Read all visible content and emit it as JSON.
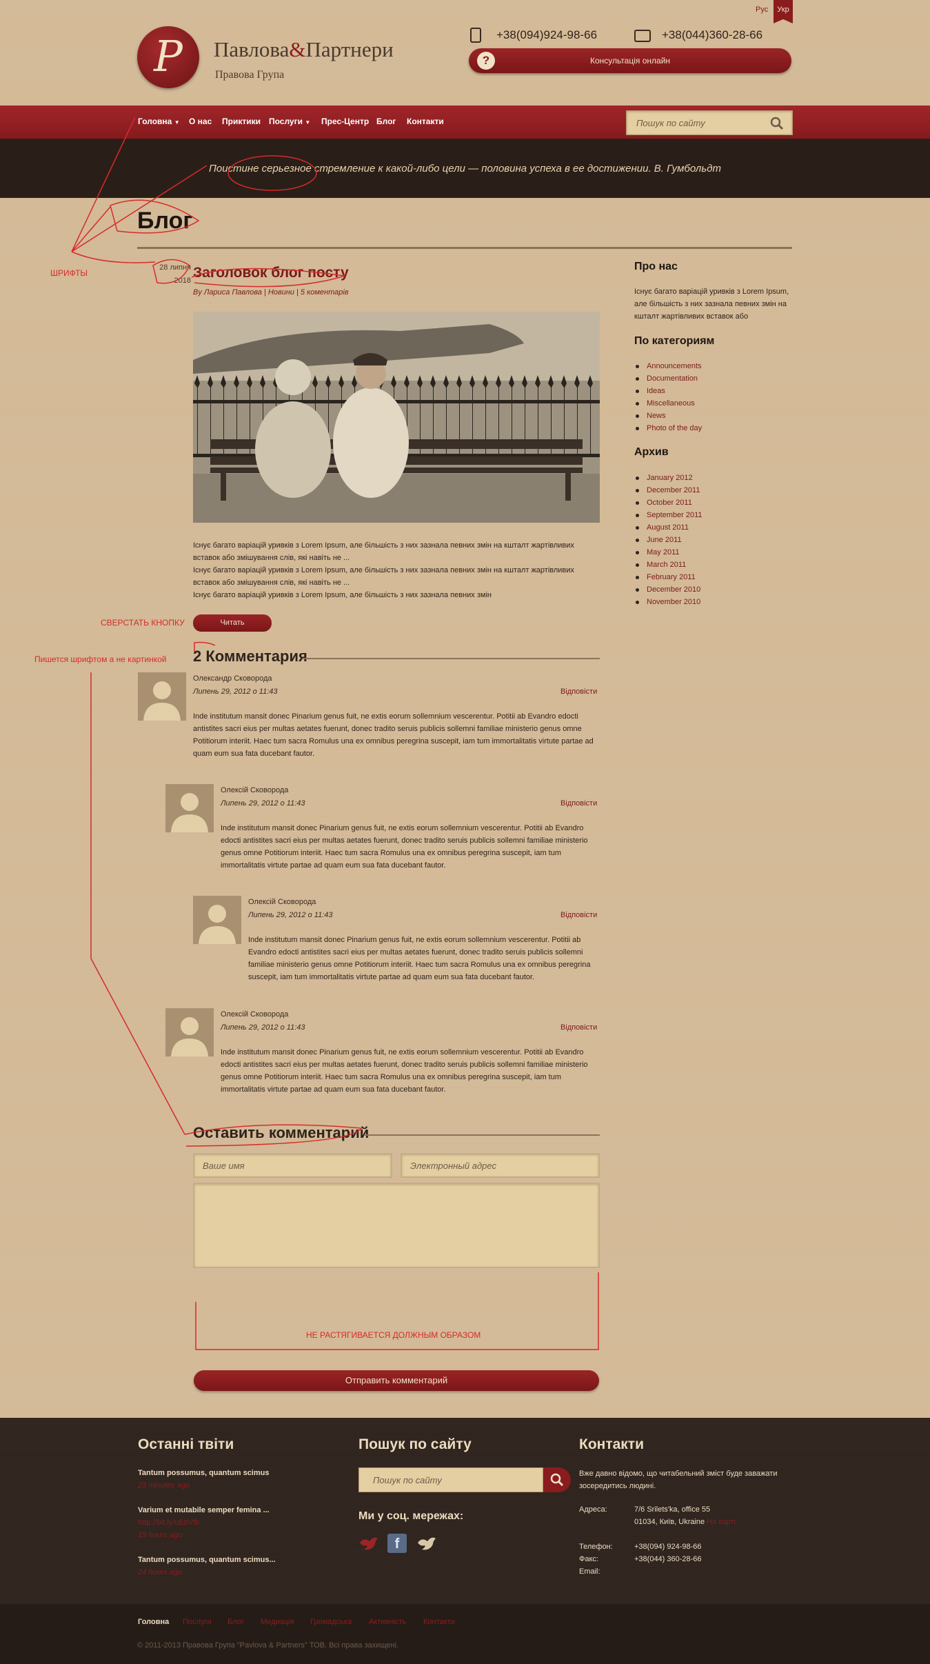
{
  "lang": {
    "ru": "Рус",
    "uk": "Укр"
  },
  "logo": {
    "letter": "P",
    "brand_left": "Павлова",
    "brand_amp": "&",
    "brand_right": "Партнери",
    "subtitle": "Правова Група"
  },
  "contacts": {
    "phone1": "+38(094)924-98-66",
    "phone2": "+38(044)360-28-66",
    "consult": "Консультація онлайн"
  },
  "nav": {
    "items": [
      "Головна",
      "О нас",
      "Приктики",
      "Послуги",
      "Прес-Центр",
      "Блог",
      "Контакти"
    ],
    "search_placeholder": "Пошук по сайту"
  },
  "quote": "Поистине серьезное стремление к какой-либо цели — половина успеха в ее достижении. В. Гумбольдт",
  "annotations": {
    "fonts": "ШРИФТЫ",
    "button": "СВЕРСТАТЬ КНОПКУ",
    "count_font": "Пишется шрифтом а не картинкой",
    "stretch": "НЕ РАСТЯГИВАЕТСЯ ДОЛЖНЫМ ОБРАЗОМ"
  },
  "page_title": "Блог",
  "post": {
    "date_day": "28 липня",
    "date_year": "2018",
    "title": "Заголовок блог посту",
    "meta": "By Лариса Павлова | Новини | 5 коментарів",
    "text": [
      "Існує багато варіацій уривків з Lorem Ipsum, але більшість з них зазнала певних змін на кшталт жартівливих",
      "вставок або змішування слів, які навіть не ...",
      "Існує багато варіацій уривків з Lorem Ipsum, але більшість з них зазнала певних змін на кшталт жартівливих",
      "вставок або змішування слів, які навіть не ...",
      "Існує багато варіацій уривків з Lorem Ipsum, але більшість з них зазнала певних змін"
    ],
    "read_more": "Читать"
  },
  "comments": {
    "count": "2",
    "title": "Комментария",
    "items": [
      {
        "author": "Олександр Сковорода",
        "date": "Липень 29, 2012 о 11:43",
        "reply": "Відповісти",
        "text": "Inde institutum mansit donec Pinarium genus fuit, ne extis eorum sollemnium vescerentur. Potitii ab Evandro edocti antistites sacri eius per multas aetates fuerunt, donec tradito seruis publicis sollemni familiae ministerio genus omne Potitiorum interiit. Haec tum sacra Romulus una ex omnibus peregrina suscepit, iam tum immortalitatis virtute partae ad quam eum sua fata ducebant fautor."
      },
      {
        "author": "Олексій Сковорода",
        "date": "Липень 29, 2012 о 11:43",
        "reply": "Відповісти",
        "text": "Inde institutum mansit donec Pinarium genus fuit, ne extis eorum sollemnium vescerentur. Potitii ab Evandro edocti antistites sacri eius per multas aetates fuerunt, donec tradito seruis publicis sollemni familiae ministerio genus omne Potitiorum interiit. Haec tum sacra Romulus una ex omnibus peregrina suscepit, iam tum immortalitatis virtute partae ad quam eum sua fata ducebant fautor."
      },
      {
        "author": "Олексій Сковорода",
        "date": "Липень 29, 2012 о 11:43",
        "reply": "Відповісти",
        "text": "Inde institutum mansit donec Pinarium genus fuit, ne extis eorum sollemnium vescerentur. Potitii ab Evandro edocti antistites sacri eius per multas aetates fuerunt, donec tradito seruis publicis sollemni familiae ministerio genus omne Potitiorum interiit. Haec tum sacra Romulus una ex omnibus peregrina suscepit, iam tum immortalitatis virtute partae ad quam eum sua fata ducebant fautor."
      },
      {
        "author": "Олексій Сковорода",
        "date": "Липень 29, 2012 о 11:43",
        "reply": "Відповісти",
        "text": "Inde institutum mansit donec Pinarium genus fuit, ne extis eorum sollemnium vescerentur. Potitii ab Evandro edocti antistites sacri eius per multas aetates fuerunt, donec tradito seruis publicis sollemni familiae ministerio genus omne Potitiorum interiit. Haec tum sacra Romulus una ex omnibus peregrina suscepit, iam tum immortalitatis virtute partae ad quam eum sua fata ducebant fautor."
      }
    ]
  },
  "form": {
    "title": "Оставить комментарий",
    "name_placeholder": "Ваше имя",
    "email_placeholder": "Электронный адрес",
    "submit": "Отправить комментарий"
  },
  "sidebar": {
    "about_title": "Про нас",
    "about_text": "Існує багато варіацій уривків з Lorem Ipsum, але більшість з них зазнала певних змін на кшталт жартівливих вставок або",
    "categories_title": "По категориям",
    "categories": [
      "Announcements",
      "Documentation",
      "Ideas",
      "Miscellaneous",
      "News",
      "Photo of the day"
    ],
    "archive_title": "Архив",
    "archive": [
      "January 2012",
      "December 2011",
      "October 2011",
      "September 2011",
      "August 2011",
      "June 2011",
      "May 2011",
      "March 2011",
      "February 2011",
      "December 2010",
      "November 2010"
    ]
  },
  "footer": {
    "tweets_title": "Останні твіти",
    "tweets": [
      {
        "text": "Tantum possumus, quantum scimus",
        "link": "",
        "time": "23 minutes ago"
      },
      {
        "text": "Varium et mutabile semper femina ...",
        "link": "http://bit.ly/uEbVfb",
        "time": "15 hours ago"
      },
      {
        "text": "Tantum possumus, quantum scimus...",
        "link": "",
        "time": "24 hours ago"
      }
    ],
    "search_title": "Пошук по сайту",
    "search_placeholder": "Пошук по сайту",
    "social_title": "Ми у соц. мережах:",
    "contacts_title": "Контакти",
    "contacts_text": "Вже давно відомо, що читабельний зміст буде заважати зосередитись людині.",
    "address_label": "Адреса:",
    "address_line1": "7/6 Srilets'ka, office 55",
    "address_line2": "01034, Київ, Ukraine",
    "map_link": "На карті",
    "phone_label": "Телефон:",
    "phone_value": "+38(094) 924-98-66",
    "fax_label": "Факс:",
    "fax_value": "+38(044) 360-28-66",
    "email_label": "Email:",
    "bottom_nav": [
      "Головна",
      "Послуги",
      "Блог",
      "Медиація",
      "Громадська",
      "Активність",
      "Контакти"
    ],
    "copyright": "© 2011-2013 Правова Група \"Pavlova & Partners\" ТОВ. Всі права захищені."
  },
  "colors": {
    "accent": "#8a1c1e",
    "background": "#d3b996",
    "dark": "#2a1e18",
    "annotation": "#d62b2b"
  }
}
